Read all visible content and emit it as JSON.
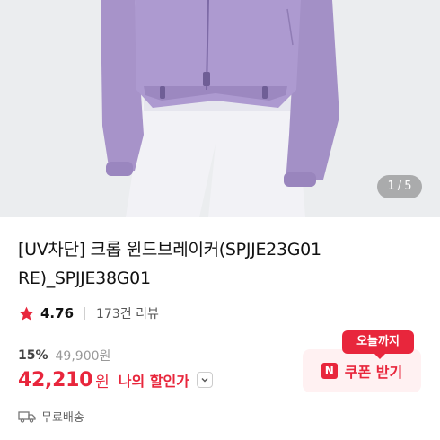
{
  "gallery": {
    "current": "1",
    "separator": "/",
    "total": "5"
  },
  "product": {
    "title_line1": "[UV차단] 크롭 윈드브레이커(SPJJE23G01",
    "title_line2": "RE)_SPJJE38G01"
  },
  "rating": {
    "value": "4.76",
    "reviews": "173건 리뷰"
  },
  "price": {
    "discount_rate": "15%",
    "original": "49,900원",
    "sale": "42,210",
    "unit": "원",
    "my_price_label": "나의 할인가"
  },
  "coupon": {
    "badge": "오늘까지",
    "icon_letter": "N",
    "label": "쿠폰 받기"
  },
  "shipping": {
    "label": "무료배송"
  },
  "colors": {
    "accent": "#e8263c",
    "coupon_bg": "#fff1f2",
    "jacket": "#a793c9",
    "pants": "#f3f3f7"
  },
  "icons": [
    "star-icon",
    "chevron-down-icon",
    "truck-icon",
    "coupon-n-icon"
  ]
}
